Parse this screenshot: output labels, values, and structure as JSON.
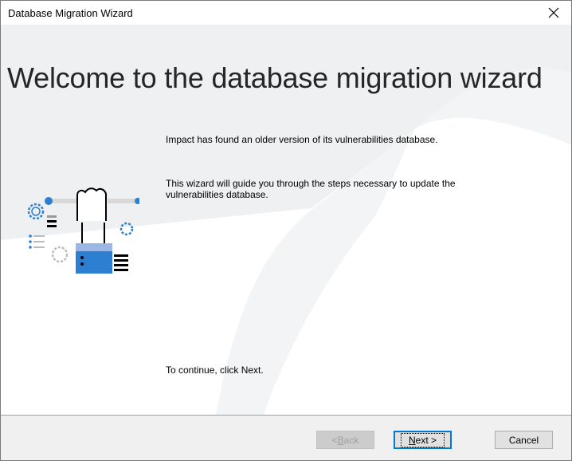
{
  "window": {
    "title": "Database Migration Wizard"
  },
  "heading": "Welcome to the database migration wizard",
  "body": {
    "paragraph1": "Impact has found an older version of its vulnerabilities database.",
    "paragraph2": "This wizard will guide you through the steps necessary to update the vulnerabilities database.",
    "continue_text": "To continue, click Next."
  },
  "buttons": {
    "back": {
      "label_prefix": "< ",
      "accesskey": "B",
      "label_suffix": "ack",
      "enabled": false
    },
    "next": {
      "accesskey": "N",
      "label_suffix": "ext >",
      "enabled": true,
      "default": true
    },
    "cancel": {
      "label": "Cancel",
      "enabled": true
    }
  },
  "icons": [
    "close-icon",
    "wizard-illustration"
  ],
  "colors": {
    "accent": "#0078d7",
    "illustration_blue": "#2c7fd1",
    "background_wave": "#eef0f1"
  }
}
